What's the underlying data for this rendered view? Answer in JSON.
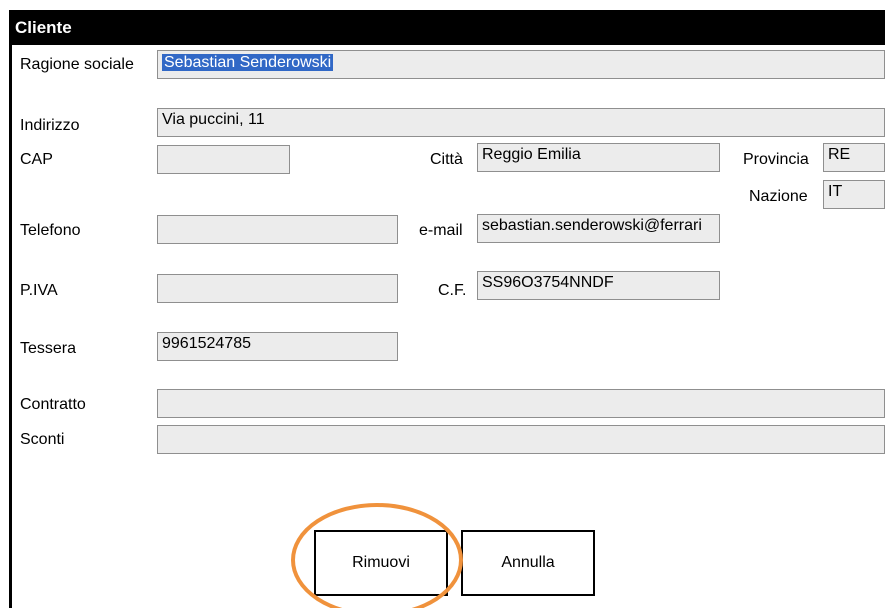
{
  "dialog": {
    "title": "Cliente"
  },
  "fields": {
    "ragione_sociale": {
      "label": "Ragione sociale",
      "value": "Sebastian Senderowski"
    },
    "indirizzo": {
      "label": "Indirizzo",
      "value": "Via puccini, 11"
    },
    "cap": {
      "label": "CAP",
      "value": ""
    },
    "citta": {
      "label": "Città",
      "value": "Reggio Emilia"
    },
    "provincia": {
      "label": "Provincia",
      "value": "RE"
    },
    "nazione": {
      "label": "Nazione",
      "value": "IT"
    },
    "telefono": {
      "label": "Telefono",
      "value": ""
    },
    "email": {
      "label": "e-mail",
      "value": "sebastian.senderowski@ferrari"
    },
    "piva": {
      "label": "P.IVA",
      "value": ""
    },
    "cf": {
      "label": "C.F.",
      "value": "SS96O3754NNDF"
    },
    "tessera": {
      "label": "Tessera",
      "value": "9961524785"
    },
    "contratto": {
      "label": "Contratto",
      "value": ""
    },
    "sconti": {
      "label": "Sconti",
      "value": ""
    }
  },
  "buttons": {
    "remove": "Rimuovi",
    "cancel": "Annulla"
  },
  "colors": {
    "selection": "#3168c6",
    "highlight_circle": "#f0923c",
    "field_bg": "#ececec"
  }
}
